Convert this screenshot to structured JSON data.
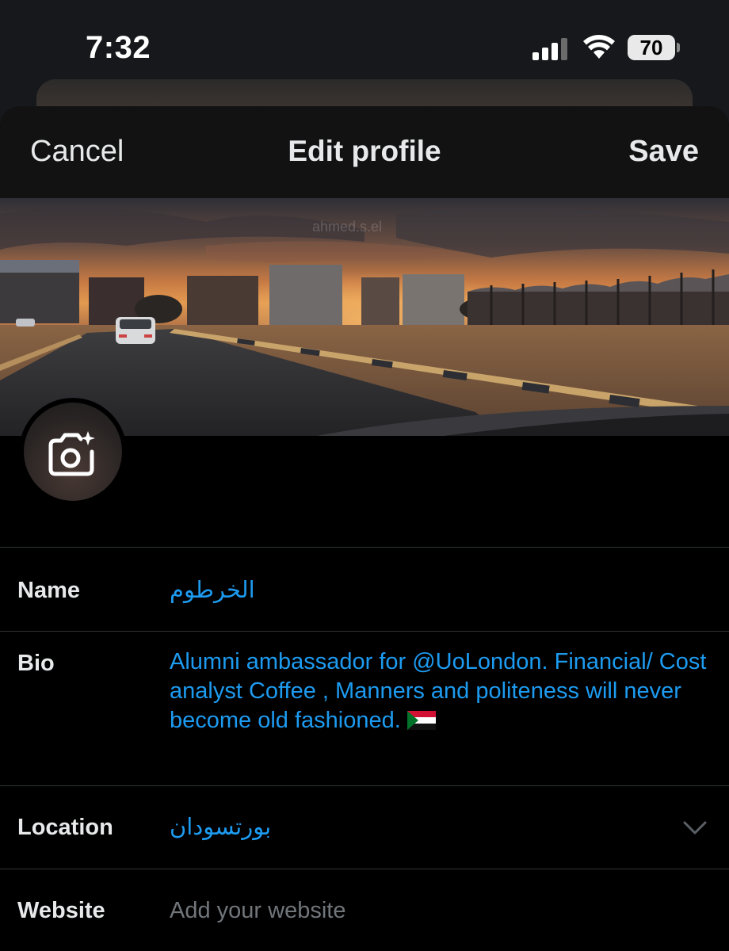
{
  "status_bar": {
    "time": "7:32",
    "battery_level": "70",
    "icons": [
      "cellular-signal-icon",
      "wifi-icon",
      "battery-icon"
    ]
  },
  "nav": {
    "cancel_label": "Cancel",
    "title": "Edit profile",
    "save_label": "Save"
  },
  "header_image": {
    "watermark": "ahmed.s.el"
  },
  "avatar": {
    "icon": "add-photo-camera-icon"
  },
  "fields": {
    "name": {
      "label": "Name",
      "value": "الخرطوم"
    },
    "bio": {
      "label": "Bio",
      "value": "Alumni ambassador for @UoLondon. Financial/ Cost analyst Coffee , Manners and politeness will never become old fashioned.",
      "emoji": "sudan-flag-icon"
    },
    "location": {
      "label": "Location",
      "value": "بورتسودان",
      "icon": "chevron-down-icon"
    },
    "website": {
      "label": "Website",
      "placeholder": "Add your website",
      "value": ""
    }
  },
  "colors": {
    "accent": "#1d9bf0",
    "background": "#000000",
    "nav_background": "#121212",
    "status_background": "#17181b",
    "divider": "#2f3336",
    "placeholder": "#71767b",
    "text": "#e7e9ea"
  }
}
